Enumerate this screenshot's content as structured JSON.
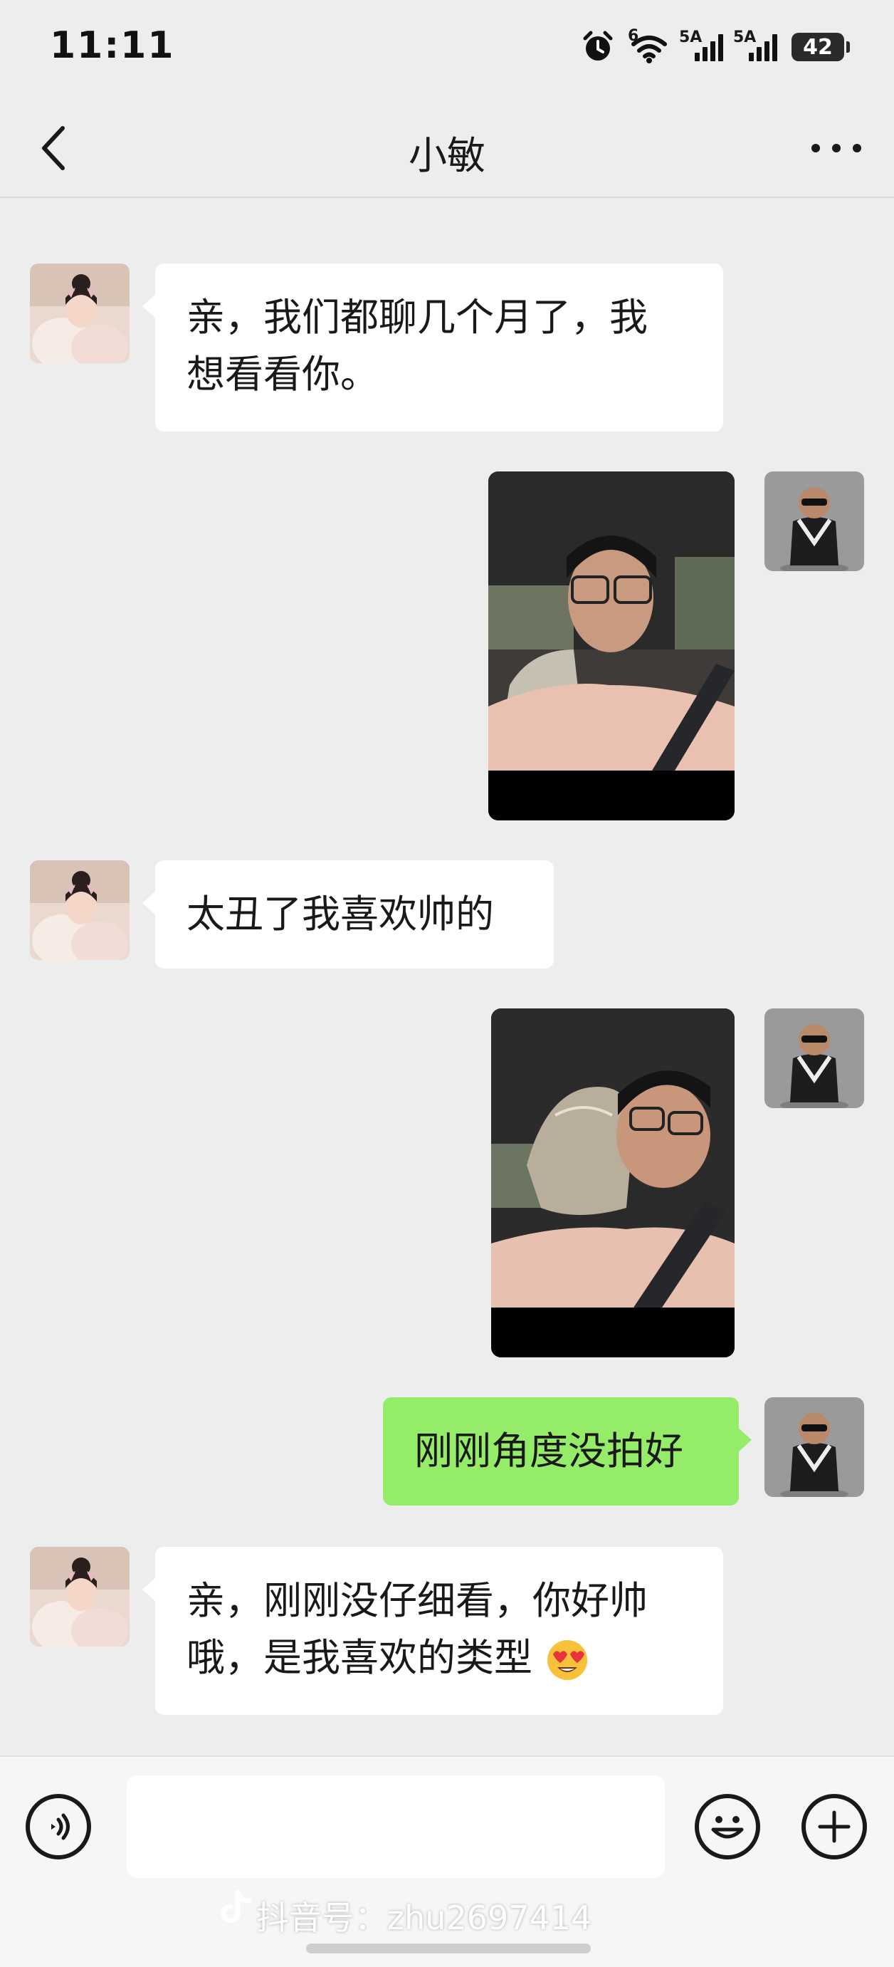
{
  "status_bar": {
    "time": "11:11",
    "network_1": "6",
    "signal_1": "5A",
    "signal_2": "5A",
    "battery": "42"
  },
  "nav": {
    "title": "小敏"
  },
  "messages": [
    {
      "side": "left",
      "type": "text",
      "text_line1": "亲，我们都聊几个月了，我",
      "text_line2": "想看看你。"
    },
    {
      "side": "right",
      "type": "photo"
    },
    {
      "side": "left",
      "type": "text",
      "text": "太丑了我喜欢帅的"
    },
    {
      "side": "right",
      "type": "photo"
    },
    {
      "side": "right",
      "type": "text",
      "text": "刚刚角度没拍好"
    },
    {
      "side": "left",
      "type": "text",
      "text_line1": "亲，刚刚没仔细看，你好帅",
      "text_line2": "哦，是我喜欢的类型",
      "emoji": "heart-eyes-emoji"
    }
  ],
  "input_bar": {
    "input_value": "",
    "watermark": "抖音号：zhu2697414"
  },
  "colors": {
    "background": "#ededed",
    "my_bubble": "#95ec69",
    "their_bubble": "#ffffff"
  }
}
